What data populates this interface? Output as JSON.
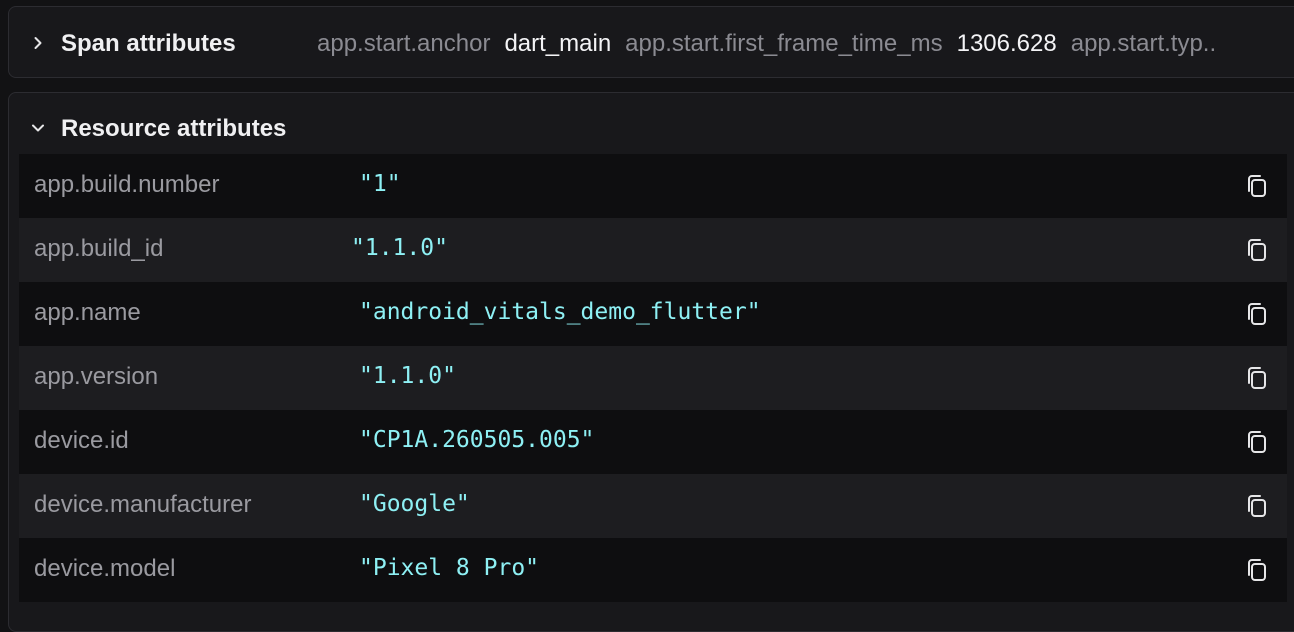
{
  "span_section": {
    "title": "Span attributes",
    "attrs": [
      {
        "key": "app.start.anchor",
        "value": "dart_main"
      },
      {
        "key": "app.start.first_frame_time_ms",
        "value": "1306.628"
      },
      {
        "key": "app.start.typ..",
        "value": ""
      }
    ]
  },
  "resource_section": {
    "title": "Resource attributes",
    "rows": [
      {
        "key": "app.build.number",
        "value": "\"1\""
      },
      {
        "key": "app.build_id",
        "value": "\"1.1.0\""
      },
      {
        "key": "app.name",
        "value": "\"android_vitals_demo_flutter\""
      },
      {
        "key": "app.version",
        "value": "\"1.1.0\""
      },
      {
        "key": "device.id",
        "value": "\"CP1A.260505.005\""
      },
      {
        "key": "device.manufacturer",
        "value": "\"Google\""
      },
      {
        "key": "device.model",
        "value": "\"Pixel 8 Pro\""
      }
    ]
  },
  "icons": {
    "collapsed": "chevron-right-icon",
    "expanded": "chevron-down-icon",
    "copy": "copy-icon"
  },
  "colors": {
    "background": "#121214",
    "value_text": "#8ef0f4",
    "key_text": "#9a9aa0"
  }
}
